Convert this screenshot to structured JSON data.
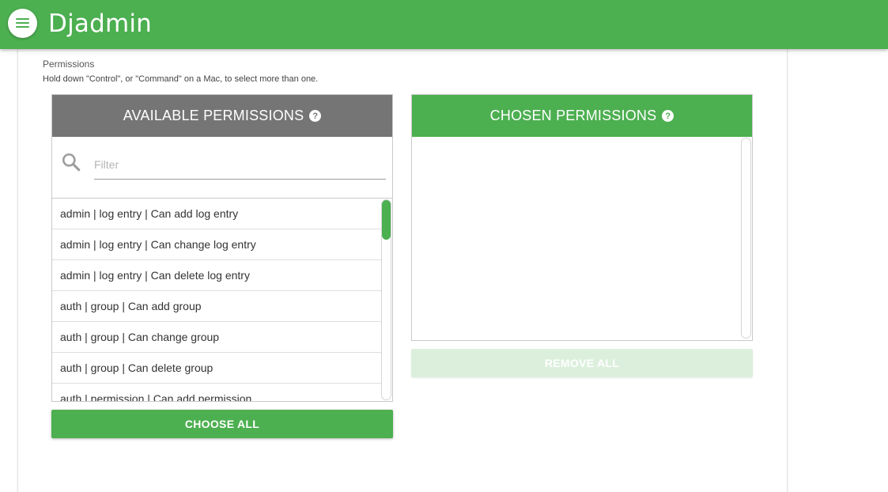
{
  "app": {
    "title": "Djadmin",
    "menu_icon": "hamburger-menu-icon"
  },
  "field": {
    "label": "Permissions",
    "help_text": "Hold down \"Control\", or \"Command\" on a Mac, to select more than one."
  },
  "available": {
    "title": "AVAILABLE PERMISSIONS",
    "help_icon": "?",
    "filter_placeholder": "Filter",
    "filter_value": "",
    "options": [
      "admin | log entry | Can add log entry",
      "admin | log entry | Can change log entry",
      "admin | log entry | Can delete log entry",
      "auth | group | Can add group",
      "auth | group | Can change group",
      "auth | group | Can delete group",
      "auth | permission | Can add permission"
    ],
    "choose_all_label": "Choose all"
  },
  "chosen": {
    "title": "CHOSEN PERMISSIONS",
    "help_icon": "?",
    "options": [],
    "remove_all_label": "Remove all"
  },
  "colors": {
    "primary": "#4caf50",
    "header_grey": "#757575",
    "disabled_green": "#dcefdd"
  }
}
